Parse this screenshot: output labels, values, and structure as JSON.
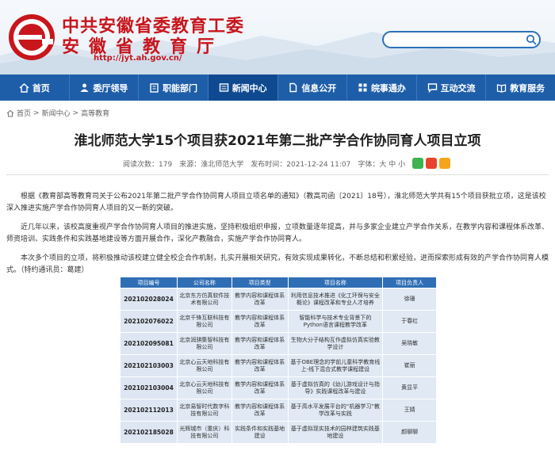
{
  "header": {
    "title_line1": "中共安徽省委教育工委",
    "title_line2": "安徽省教育厅",
    "url": "http://jyt.ah.gov.cn/",
    "search_placeholder": ""
  },
  "nav": {
    "items": [
      {
        "label": "首页",
        "icon": "home-icon"
      },
      {
        "label": "委厅领导",
        "icon": "people-icon"
      },
      {
        "label": "职能部门",
        "icon": "building-icon"
      },
      {
        "label": "新闻中心",
        "icon": "news-icon",
        "active": true
      },
      {
        "label": "信息公开",
        "icon": "document-icon"
      },
      {
        "label": "皖事通办",
        "icon": "service-icon"
      },
      {
        "label": "互动交流",
        "icon": "chat-icon"
      },
      {
        "label": "教育服务",
        "icon": "book-icon"
      }
    ]
  },
  "breadcrumb": {
    "items": [
      "首页",
      "新闻中心",
      "高等教育"
    ],
    "separator": ">"
  },
  "article": {
    "title": "淮北师范大学15个项目获2021年第二批产学合作协同育人项目立项",
    "views_label": "阅读次数：",
    "views": "179",
    "source_label": "来源：",
    "source": "淮北师范大学",
    "date_label": "发布时间：",
    "date": "2021-12-24 11:07",
    "font_label": "字体：",
    "font_large": "大",
    "font_medium": "中",
    "font_small": "小",
    "paragraphs": [
      "根据《教育部高等教育司关于公布2021年第二批产学合作协同育人项目立项名单的通知》（教高司函〔2021〕18号），淮北师范大学共有15个项目获批立项，这是该校深入推进实施产学合作协同育人项目的又一新的突破。",
      "近几年以来，该校高度重视产学合作协同育人项目的推进实施，坚持积极组织申报，立项数量逐年提高，并与多家企业建立产学合作关系，在教学内容和课程体系改革、师资培训、实践条件和实践基地建设等方面开展合作，深化产教融合，实施产学合作协同育人。",
      "本次多个项目的立项，将积极推动该校建立健全校企合作机制，扎实开展相关研究，有效实现成果转化，不断总结和积累经验，进而探索形成有效的产学合作协同育人模式。（特约通讯员：葛建）"
    ]
  },
  "table": {
    "headers": [
      "项目编号",
      "公司名称",
      "项目类型",
      "项目名称",
      "项目负责人"
    ],
    "rows": [
      [
        "202102028024",
        "北京东方仿真软件技术有限公司",
        "教学内容和课程体系改革",
        "利用信息技术推进《化工环保与安全概论》课程改革和专业人才培养",
        "徐珊"
      ],
      [
        "202102076022",
        "北京千锋互联科技有限公司",
        "教学内容和课程体系改革",
        "智能科学与技术专业背景下的Python语言课程教学改革",
        "于春红"
      ],
      [
        "202102095081",
        "北京润骐集智科技有限公司",
        "教学内容和课程体系改革",
        "生物大分子结构互作虚拟仿真实验教学设计",
        "吴晓敏"
      ],
      [
        "202102103003",
        "北京心云天地科技有限公司",
        "教学内容和课程体系改革",
        "基于OBE理念的学前儿童科学教育线上-线下混合式教学课程建设",
        "崔丽"
      ],
      [
        "202102103004",
        "北京心云天地科技有限公司",
        "教学内容和课程体系改革",
        "基于虚拟仿真的《幼儿游戏设计与指导》实践课程改革与建设",
        "黄显平"
      ],
      [
        "202102112013",
        "北京易智时代数字科技有限公司",
        "教学内容和课程体系改革",
        "基于高水平发展平台的“机器学习”教学改革与实践",
        "王婧"
      ],
      [
        "202102185028",
        "光辉城市（重庆）科技有限公司",
        "实践条件和实践基地建设",
        "基于虚拟现实技术的园林建筑实践基地建设",
        "颜聊聊"
      ]
    ]
  },
  "colors": {
    "brand_red": "#c8161d",
    "nav_blue": "#1e5ea9",
    "nav_active": "#0f4a90",
    "table_header": "#2f6eb5",
    "table_cell": "#e0e9f4"
  }
}
